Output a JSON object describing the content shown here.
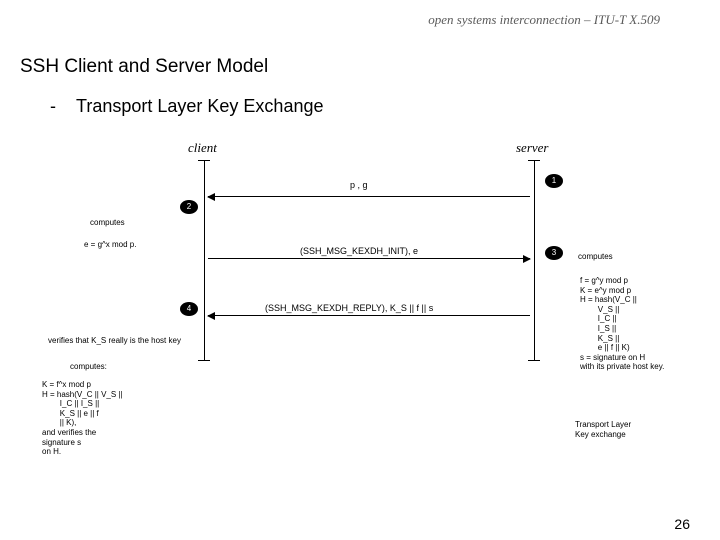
{
  "header": "open systems interconnection – ITU-T X.509",
  "title": "SSH Client and Server Model",
  "bullet": "-",
  "subtitle": "Transport Layer Key Exchange",
  "roles": {
    "client": "client",
    "server": "server"
  },
  "steps": {
    "n1": "1",
    "n2": "2",
    "n3": "3",
    "n4": "4"
  },
  "messages": {
    "m1": "p , g",
    "m2": "(SSH_MSG_KEXDH_INIT), e",
    "m3": "(SSH_MSG_KEXDH_REPLY), K_S || f || s"
  },
  "notes": {
    "computes_c": "computes",
    "e_eq": "e = g^x mod p.",
    "computes_s": "computes",
    "fblock": "f = g^y mod p\nK = e^y mod p\nH = hash(V_C ||\n        V_S ||\n        I_C ||\n        I_S ||\n        K_S ||\n        e || f || K)\ns = signature on H\nwith its private host key.",
    "verify": "verifies that K_S really is the host key",
    "computes2": "computes:",
    "kblock": "K = f^x mod p\nH = hash(V_C || V_S ||\n        I_C || I_S ||\n        K_S || e || f\n        || K),\nand verifies the\nsignature s\non H.",
    "transport": "Transport Layer\nKey exchange"
  },
  "page": "26"
}
